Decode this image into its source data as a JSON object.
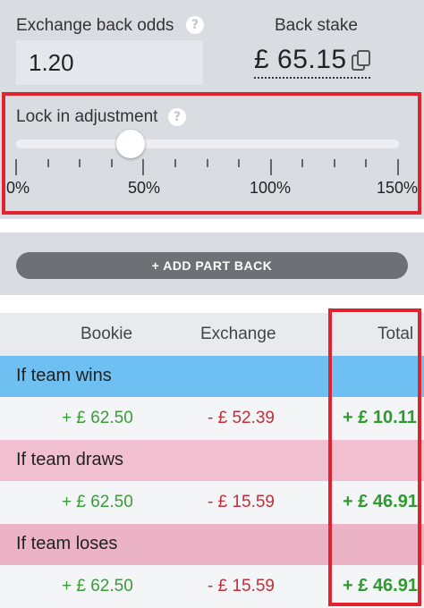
{
  "exchange_odds": {
    "label": "Exchange back odds",
    "value": "1.20"
  },
  "back_stake": {
    "label": "Back stake",
    "value": "£ 65.15"
  },
  "lock": {
    "label": "Lock in adjustment",
    "slider_value_pct": 45,
    "ticks": [
      "0%",
      "50%",
      "100%",
      "150%"
    ]
  },
  "add_part_back": {
    "label": "+ ADD PART BACK"
  },
  "table": {
    "headers": {
      "bookie": "Bookie",
      "exchange": "Exchange",
      "total": "Total"
    },
    "outcomes": [
      {
        "label": "If team wins",
        "bookie": "+ £ 62.50",
        "exchange": "- £ 52.39",
        "total": "+ £ 10.11",
        "color": "#6ec0f2"
      },
      {
        "label": "If team draws",
        "bookie": "+ £ 62.50",
        "exchange": "- £ 15.59",
        "total": "+ £ 46.91",
        "color": "#f1c0d0"
      },
      {
        "label": "If team loses",
        "bookie": "+ £ 62.50",
        "exchange": "- £ 15.59",
        "total": "+ £ 46.91",
        "color": "#ecb2c5"
      }
    ]
  },
  "colors": {
    "highlight": "#e0232e",
    "positive": "#2f9a2f",
    "negative": "#c0303a"
  },
  "icons": {
    "help": "question-circle-icon",
    "copy": "copy-icon"
  }
}
